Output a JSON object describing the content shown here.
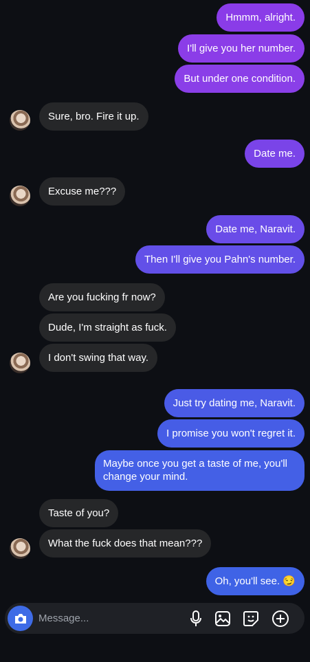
{
  "colors": {
    "background": "#0d0f14",
    "incoming_bubble": "#262729",
    "outgoing_gradient_top": "#8a3ce8",
    "outgoing_gradient_bottom": "#3f63e6",
    "composer_bg": "#1f2126",
    "camera_button": "#3e6be6"
  },
  "messages": [
    {
      "side": "out",
      "text": "Hmmm, alright."
    },
    {
      "side": "out",
      "text": "I'll give you her number."
    },
    {
      "side": "out",
      "text": "But under one condition."
    },
    {
      "side": "in",
      "text": "Sure, bro. Fire it up."
    },
    {
      "side": "out",
      "text": "Date me."
    },
    {
      "side": "in",
      "text": "Excuse me???"
    },
    {
      "side": "out",
      "text": "Date me, Naravit."
    },
    {
      "side": "out",
      "text": "Then I'll give you Pahn's number."
    },
    {
      "side": "in",
      "text": "Are you fucking fr now?"
    },
    {
      "side": "in",
      "text": "Dude, I'm straight as fuck."
    },
    {
      "side": "in",
      "text": "I don't swing that way."
    },
    {
      "side": "out",
      "text": "Just try dating me, Naravit."
    },
    {
      "side": "out",
      "text": "I promise you won't regret it."
    },
    {
      "side": "out",
      "text": "Maybe once you get a taste of me, you'll change your mind."
    },
    {
      "side": "in",
      "text": "Taste of you?"
    },
    {
      "side": "in",
      "text": "What the fuck does that mean???"
    },
    {
      "side": "out",
      "text": "Oh, you'll see. 😏"
    }
  ],
  "composer": {
    "placeholder": "Message...",
    "icons": [
      "camera-icon",
      "microphone-icon",
      "image-icon",
      "sticker-icon",
      "plus-circle-icon"
    ]
  }
}
